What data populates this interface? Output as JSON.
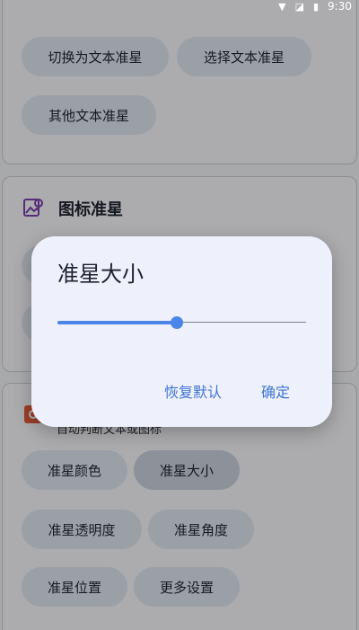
{
  "status_bar": {
    "time": "9:30"
  },
  "text_crosshair_card": {
    "buttons": [
      "切换为文本准星",
      "选择文本准星",
      "其他文本准星"
    ]
  },
  "icon_crosshair_card": {
    "title": "图标准星"
  },
  "settings_card": {
    "subtitle": "自动判断文本或图标",
    "buttons": [
      "准星颜色",
      "准星大小",
      "准星透明度",
      "准星角度",
      "准星位置",
      "更多设置"
    ],
    "selected_index": 1
  },
  "dialog": {
    "title": "准星大小",
    "slider_fraction": 0.48,
    "reset_label": "恢复默认",
    "confirm_label": "确定"
  },
  "colors": {
    "accent": "#4a86e8",
    "chip_bg": "#dfe4ee",
    "dialog_bg": "#eef1fb"
  }
}
